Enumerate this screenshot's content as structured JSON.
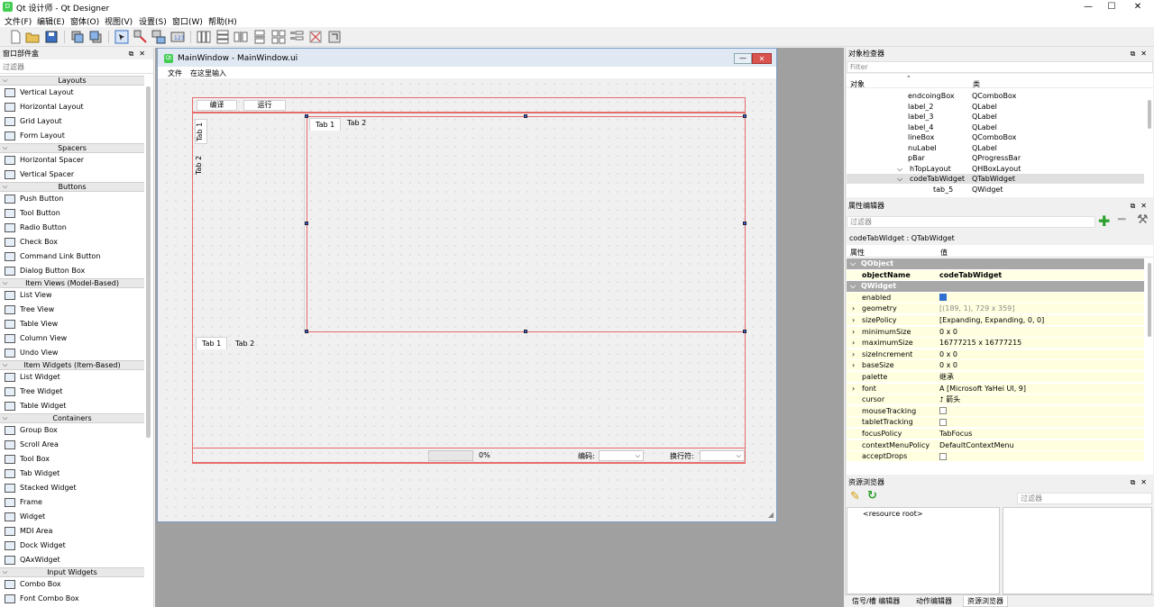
{
  "window": {
    "title": "Qt 设计师 - Qt Designer",
    "min": "—",
    "max": "☐",
    "close": "✕"
  },
  "menu": [
    "文件(F)",
    "编辑(E)",
    "窗体(O)",
    "视图(V)",
    "设置(S)",
    "窗口(W)",
    "帮助(H)"
  ],
  "widgetbox": {
    "title": "窗口部件盒",
    "filter_placeholder": "过滤器",
    "sections": [
      {
        "name": "Layouts",
        "items": [
          "Vertical Layout",
          "Horizontal Layout",
          "Grid Layout",
          "Form Layout"
        ]
      },
      {
        "name": "Spacers",
        "items": [
          "Horizontal Spacer",
          "Vertical Spacer"
        ]
      },
      {
        "name": "Buttons",
        "items": [
          "Push Button",
          "Tool Button",
          "Radio Button",
          "Check Box",
          "Command Link Button",
          "Dialog Button Box"
        ]
      },
      {
        "name": "Item Views (Model-Based)",
        "items": [
          "List View",
          "Tree View",
          "Table View",
          "Column View",
          "Undo View"
        ]
      },
      {
        "name": "Item Widgets (Item-Based)",
        "items": [
          "List Widget",
          "Tree Widget",
          "Table Widget"
        ]
      },
      {
        "name": "Containers",
        "items": [
          "Group Box",
          "Scroll Area",
          "Tool Box",
          "Tab Widget",
          "Stacked Widget",
          "Frame",
          "Widget",
          "MDI Area",
          "Dock Widget",
          "QAxWidget"
        ]
      },
      {
        "name": "Input Widgets",
        "items": [
          "Combo Box",
          "Font Combo Box"
        ]
      }
    ]
  },
  "form": {
    "title": "MainWindow - MainWindow.ui",
    "menu_file": "文件",
    "menu_type_here": "在这里输入",
    "btn_compile": "编译",
    "btn_run": "运行",
    "top_tabs": [
      "Tab 1",
      "Tab 2"
    ],
    "vertical_tabs": [
      "Tab 1",
      "Tab 2"
    ],
    "bottom_tabs": [
      "Tab 1",
      "Tab 2"
    ],
    "progress_text": "0%",
    "encoding_label": "编码:",
    "newline_label": "换行符:"
  },
  "object_inspector": {
    "title": "对象检查器",
    "filter_placeholder": "Filter",
    "col_object": "对象",
    "col_class": "类",
    "rows": [
      {
        "name": "endcoingBox",
        "cls": "QComboBox",
        "indent": 68
      },
      {
        "name": "label_2",
        "cls": "QLabel",
        "indent": 68
      },
      {
        "name": "label_3",
        "cls": "QLabel",
        "indent": 68
      },
      {
        "name": "label_4",
        "cls": "QLabel",
        "indent": 68
      },
      {
        "name": "lineBox",
        "cls": "QComboBox",
        "indent": 68
      },
      {
        "name": "nuLabel",
        "cls": "QLabel",
        "indent": 68
      },
      {
        "name": "pBar",
        "cls": "QProgressBar",
        "indent": 68
      },
      {
        "name": "hTopLayout",
        "cls": "QHBoxLayout",
        "indent": 70
      },
      {
        "name": "codeTabWidget",
        "cls": "QTabWidget",
        "indent": 70
      },
      {
        "name": "tab_5",
        "cls": "QWidget",
        "indent": 96
      }
    ]
  },
  "property_editor": {
    "title": "属性编辑器",
    "filter_placeholder": "过滤器",
    "context": "codeTabWidget : QTabWidget",
    "col_property": "属性",
    "col_value": "值",
    "group_qobject": "QObject",
    "group_qwidget": "QWidget",
    "rows": [
      {
        "name": "objectName",
        "value": "codeTabWidget",
        "bold": true,
        "group": "qobject"
      },
      {
        "name": "enabled",
        "value": "",
        "check": "on"
      },
      {
        "name": "geometry",
        "value": "[(189, 1), 729 x 359]",
        "expand": true
      },
      {
        "name": "sizePolicy",
        "value": "[Expanding, Expanding, 0, 0]",
        "expand": true
      },
      {
        "name": "minimumSize",
        "value": "0 x 0",
        "expand": true
      },
      {
        "name": "maximumSize",
        "value": "16777215 x 16777215",
        "expand": true
      },
      {
        "name": "sizeIncrement",
        "value": "0 x 0",
        "expand": true
      },
      {
        "name": "baseSize",
        "value": "0 x 0",
        "expand": true
      },
      {
        "name": "palette",
        "value": "继承"
      },
      {
        "name": "font",
        "value": "A  [Microsoft YaHei UI, 9]",
        "expand": true
      },
      {
        "name": "cursor",
        "value": "⮥  箭头"
      },
      {
        "name": "mouseTracking",
        "value": "",
        "check": "off"
      },
      {
        "name": "tabletTracking",
        "value": "",
        "check": "off"
      },
      {
        "name": "focusPolicy",
        "value": "TabFocus"
      },
      {
        "name": "contextMenuPolicy",
        "value": "DefaultContextMenu"
      },
      {
        "name": "acceptDrops",
        "value": "",
        "check": "off"
      }
    ]
  },
  "resource_browser": {
    "title": "资源浏览器",
    "filter_placeholder": "过滤器",
    "root": "<resource root>"
  },
  "bottom_tabs": [
    "信号/槽 编辑器",
    "动作编辑器",
    "资源浏览器"
  ],
  "colors": {
    "selection_red": "#e86b6b",
    "handle_blue": "#3b5fd6",
    "prop_yellow": "#ffffe0",
    "group_gray": "#a8a8a8"
  }
}
